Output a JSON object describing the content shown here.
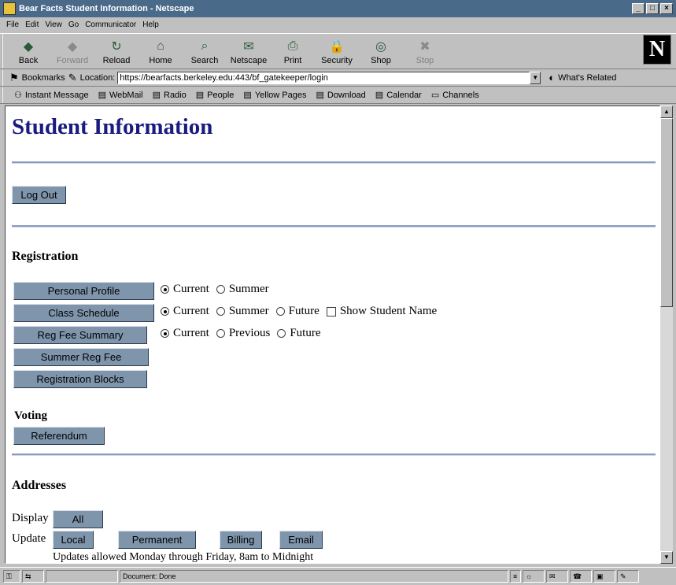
{
  "window": {
    "title": "Bear Facts Student Information - Netscape"
  },
  "menu": [
    "File",
    "Edit",
    "View",
    "Go",
    "Communicator",
    "Help"
  ],
  "toolbar": [
    {
      "label": "Back",
      "icon": "back-icon",
      "glyph": "◆",
      "disabled": false
    },
    {
      "label": "Forward",
      "icon": "forward-icon",
      "glyph": "◆",
      "disabled": true
    },
    {
      "label": "Reload",
      "icon": "reload-icon",
      "glyph": "↻",
      "disabled": false
    },
    {
      "label": "Home",
      "icon": "home-icon",
      "glyph": "⌂",
      "disabled": false
    },
    {
      "label": "Search",
      "icon": "search-icon",
      "glyph": "⌕",
      "disabled": false
    },
    {
      "label": "Netscape",
      "icon": "netscape-icon",
      "glyph": "✉",
      "disabled": false
    },
    {
      "label": "Print",
      "icon": "print-icon",
      "glyph": "⎙",
      "disabled": false
    },
    {
      "label": "Security",
      "icon": "security-icon",
      "glyph": "🔒",
      "disabled": false
    },
    {
      "label": "Shop",
      "icon": "shop-icon",
      "glyph": "◎",
      "disabled": false
    },
    {
      "label": "Stop",
      "icon": "stop-icon",
      "glyph": "✖",
      "disabled": true
    }
  ],
  "location": {
    "bookmarks_label": "Bookmarks",
    "location_label": "Location:",
    "url": "https://bearfacts.berkeley.edu:443/bf_gatekeeper/login",
    "related_label": "What's Related"
  },
  "personal_toolbar": [
    "Instant Message",
    "WebMail",
    "Radio",
    "People",
    "Yellow Pages",
    "Download",
    "Calendar",
    "Channels"
  ],
  "page": {
    "title": "Student Information",
    "logout_label": "Log Out",
    "registration": {
      "heading": "Registration",
      "personal_profile": "Personal Profile",
      "class_schedule": "Class Schedule",
      "reg_fee_summary": "Reg Fee Summary",
      "summer_reg_fee": "Summer Reg Fee",
      "registration_blocks": "Registration Blocks",
      "opt_current": "Current",
      "opt_summer": "Summer",
      "opt_future": "Future",
      "opt_previous": "Previous",
      "show_student_name": "Show Student Name"
    },
    "voting": {
      "heading": "Voting",
      "referendum": "Referendum"
    },
    "addresses": {
      "heading": "Addresses",
      "display_label": "Display",
      "all_label": "All",
      "update_label": "Update",
      "local": "Local",
      "permanent": "Permanent",
      "billing": "Billing",
      "email": "Email",
      "note": "Updates allowed Monday through Friday, 8am to Midnight"
    }
  },
  "status": {
    "text": "Document: Done"
  },
  "colors": {
    "title_bar": "#4a6a8a",
    "heading_blue": "#1a1a80",
    "button_bg": "#7f95ac",
    "rule": "#8a9abf"
  }
}
